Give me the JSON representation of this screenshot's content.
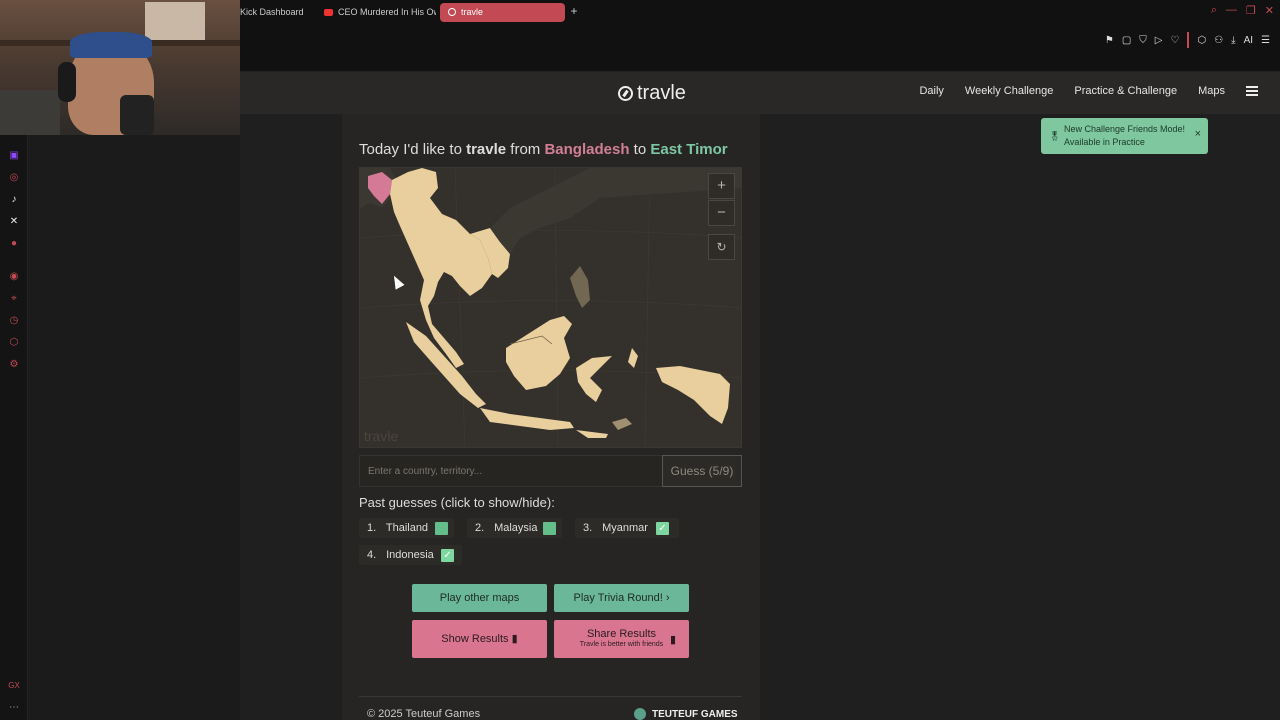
{
  "browser": {
    "tabs": [
      {
        "label": "Kick Dashboard",
        "active": false,
        "icon": "kick-icon"
      },
      {
        "label": "CEO Murdered In His Own",
        "active": false,
        "icon": "youtube-icon"
      },
      {
        "label": "travle",
        "active": true,
        "icon": "travle-icon"
      }
    ],
    "new_tab": "+",
    "window_controls": [
      "search-icon",
      "minimize-icon",
      "restore-icon",
      "close-icon"
    ],
    "toolbar_ai_label": "AI"
  },
  "nav": {
    "logo_text": "travle",
    "links": [
      "Daily",
      "Weekly Challenge",
      "Practice & Challenge",
      "Maps"
    ]
  },
  "toast": {
    "line1": "New Challenge Friends Mode!",
    "line2": "Available in Practice",
    "close": "×"
  },
  "headline": {
    "prefix": "Today I'd like to",
    "game": "travle",
    "from_word": "from",
    "from": "Bangladesh",
    "to_word": "to",
    "to": "East Timor"
  },
  "map": {
    "watermark": "travle",
    "zoom_in": "+",
    "zoom_out": "−",
    "reset": "↻"
  },
  "guess": {
    "placeholder": "Enter a country, territory...",
    "button": "Guess (5/9)"
  },
  "past": {
    "label": "Past guesses (click to show/hide):",
    "items": [
      {
        "index": "1.",
        "name": "Thailand",
        "status": "green"
      },
      {
        "index": "2.",
        "name": "Malaysia",
        "status": "green"
      },
      {
        "index": "3.",
        "name": "Myanmar",
        "status": "checked"
      },
      {
        "index": "4.",
        "name": "Indonesia",
        "status": "checked"
      }
    ]
  },
  "buttons": {
    "play_other_maps": "Play other maps",
    "play_trivia": "Play Trivia Round!",
    "show_results": "Show Results",
    "share_results": "Share Results",
    "share_sub": "Travle is better with friends"
  },
  "footer": {
    "copyright": "© 2025 Teuteuf Games",
    "brand": "TEUTEUF GAMES"
  },
  "colors": {
    "accent_pink": "#d27f96",
    "accent_teal": "#7ec7a5",
    "land": "#e9cf9e",
    "start_country": "#d47a96"
  }
}
